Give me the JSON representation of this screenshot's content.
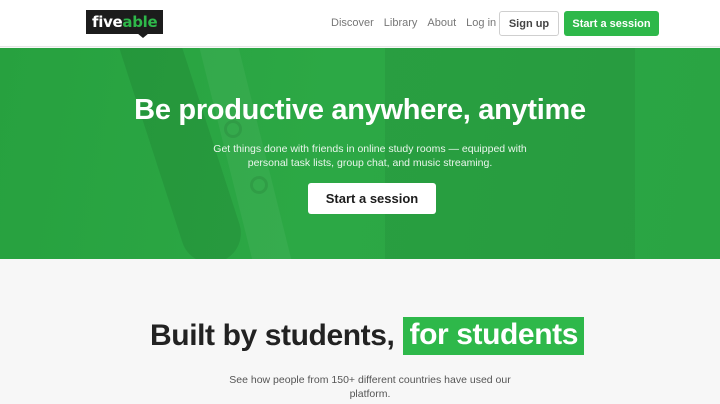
{
  "logo": {
    "part1": "five",
    "part2": "able"
  },
  "nav": {
    "discover": "Discover",
    "library": "Library",
    "about": "About",
    "login": "Log in"
  },
  "header": {
    "signup": "Sign up",
    "start": "Start a session"
  },
  "hero": {
    "title": "Be productive anywhere, anytime",
    "subtitle": "Get things done with friends in online study rooms — equipped with personal task lists, group chat, and music streaming.",
    "button": "Start a session"
  },
  "section": {
    "title_part1": "Built by students,",
    "title_highlight": "for students",
    "subtitle": "See how people from 150+ different countries have used our platform."
  },
  "colors": {
    "brand_green": "#2eb84a",
    "logo_bg": "#1c1c1c"
  }
}
